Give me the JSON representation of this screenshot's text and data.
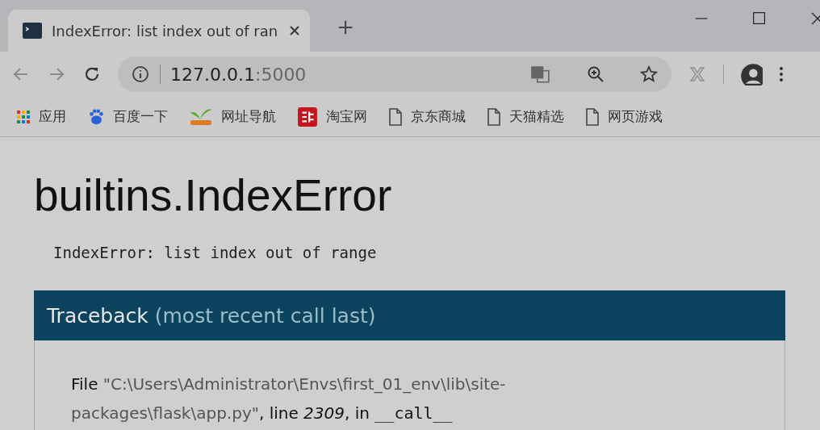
{
  "tab": {
    "title": "IndexError: list index out of ran",
    "selected": true
  },
  "address": {
    "host": "127.0.0.1",
    "port": ":5000"
  },
  "bookmarks": [
    {
      "kind": "apps",
      "label": "应用"
    },
    {
      "kind": "baidu",
      "label": "百度一下"
    },
    {
      "kind": "hao",
      "label": "网址导航"
    },
    {
      "kind": "taobao",
      "label": "淘宝网"
    },
    {
      "kind": "page",
      "label": "京东商城"
    },
    {
      "kind": "page",
      "label": "天猫精选"
    },
    {
      "kind": "page",
      "label": "网页游戏"
    }
  ],
  "page": {
    "heading": "builtins.IndexError",
    "message": "IndexError: list index out of range",
    "traceback": {
      "title": "Traceback",
      "subtitle": "(most recent call last)",
      "frames": [
        {
          "file_label": "File",
          "path": "\"C:\\Users\\Administrator\\Envs\\first_01_env\\lib\\site-packages\\flask\\app.py\"",
          "line_label": ", line",
          "line": "2309",
          "in_label": ", in",
          "function": "__call__"
        }
      ]
    }
  }
}
